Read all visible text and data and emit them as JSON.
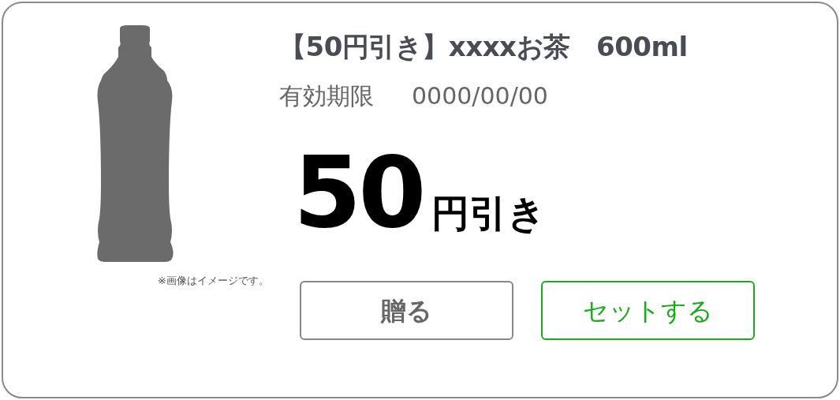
{
  "coupon": {
    "title": "【50円引き】xxxxお茶　600ml",
    "expiry_label": "有効期限",
    "expiry_date": "0000/00/00",
    "discount_amount": "50",
    "discount_unit": "円引き",
    "image_note": "※画像はイメージです。",
    "buttons": [
      {
        "label": "贈る",
        "kind": "secondary"
      },
      {
        "label": "セットする",
        "kind": "primary"
      }
    ]
  }
}
